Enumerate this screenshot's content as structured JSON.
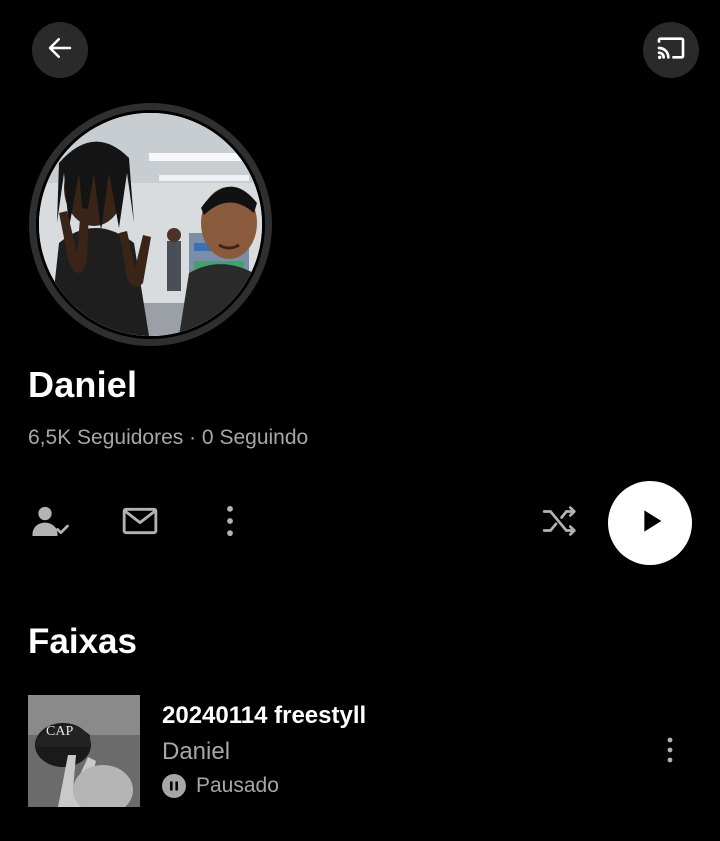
{
  "header": {
    "back_icon": "arrow-left-icon",
    "cast_icon": "cast-icon"
  },
  "profile": {
    "name": "Daniel",
    "stats": "6,5K Seguidores · 0 Seguindo",
    "avatar_description": "profile photo"
  },
  "actions": {
    "follow_icon": "person-check-icon",
    "message_icon": "mail-icon",
    "more_icon": "vertical-dots-icon",
    "shuffle_icon": "shuffle-icon",
    "play_icon": "play-icon"
  },
  "tracks_section": {
    "title": "Faixas",
    "items": [
      {
        "title": "20240114 freestyll",
        "artist": "Daniel",
        "status": "Pausado"
      }
    ]
  },
  "colors": {
    "background": "#000000",
    "text_primary": "#ffffff",
    "text_secondary": "#a7a7a7",
    "button_bg": "#2a2a2a",
    "play_button_bg": "#ffffff"
  }
}
